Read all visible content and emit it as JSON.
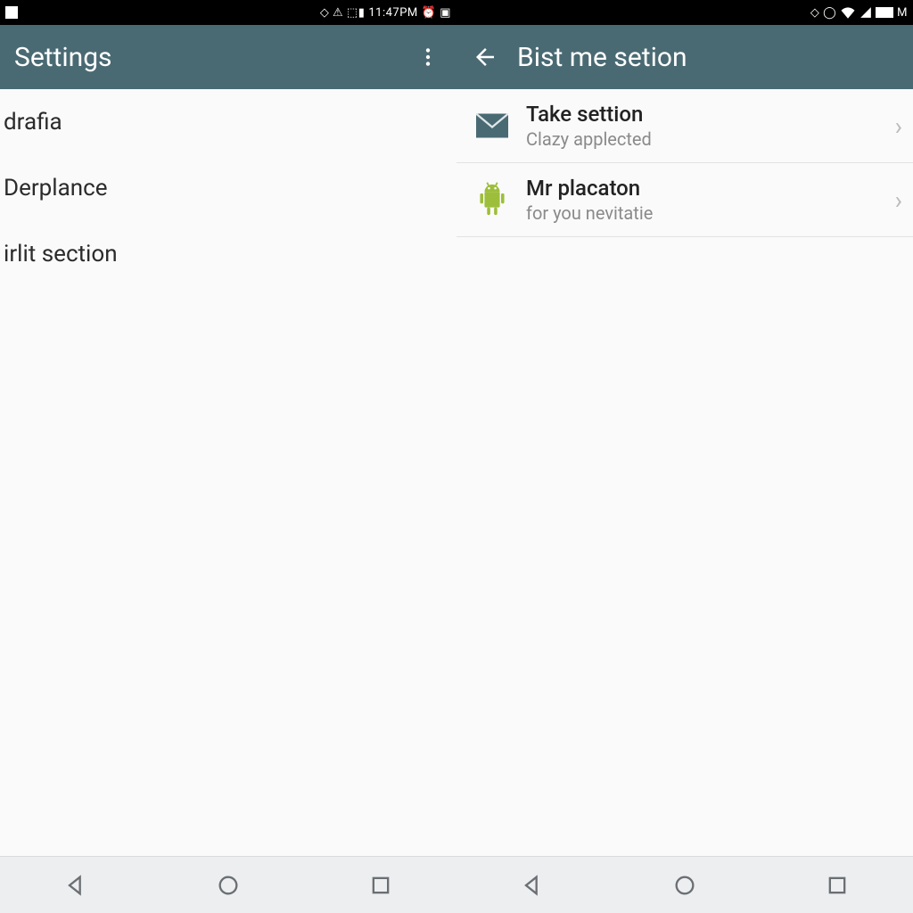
{
  "status": {
    "time": "11:47PM",
    "right_label": "M"
  },
  "left": {
    "appbar": {
      "title": "Settings"
    },
    "items": [
      {
        "label": "drafia"
      },
      {
        "label": "Derplance"
      },
      {
        "label": "irlit section"
      }
    ]
  },
  "right": {
    "appbar": {
      "title": "Bist me setion"
    },
    "items": [
      {
        "icon": "mail",
        "title": "Take settion",
        "subtitle": "Clazy applected"
      },
      {
        "icon": "android",
        "title": "Mr placaton",
        "subtitle": "for you nevitatie"
      }
    ]
  },
  "colors": {
    "appbar": "#4a6a73",
    "android": "#9dbe3a",
    "mail": "#4a6a73"
  }
}
